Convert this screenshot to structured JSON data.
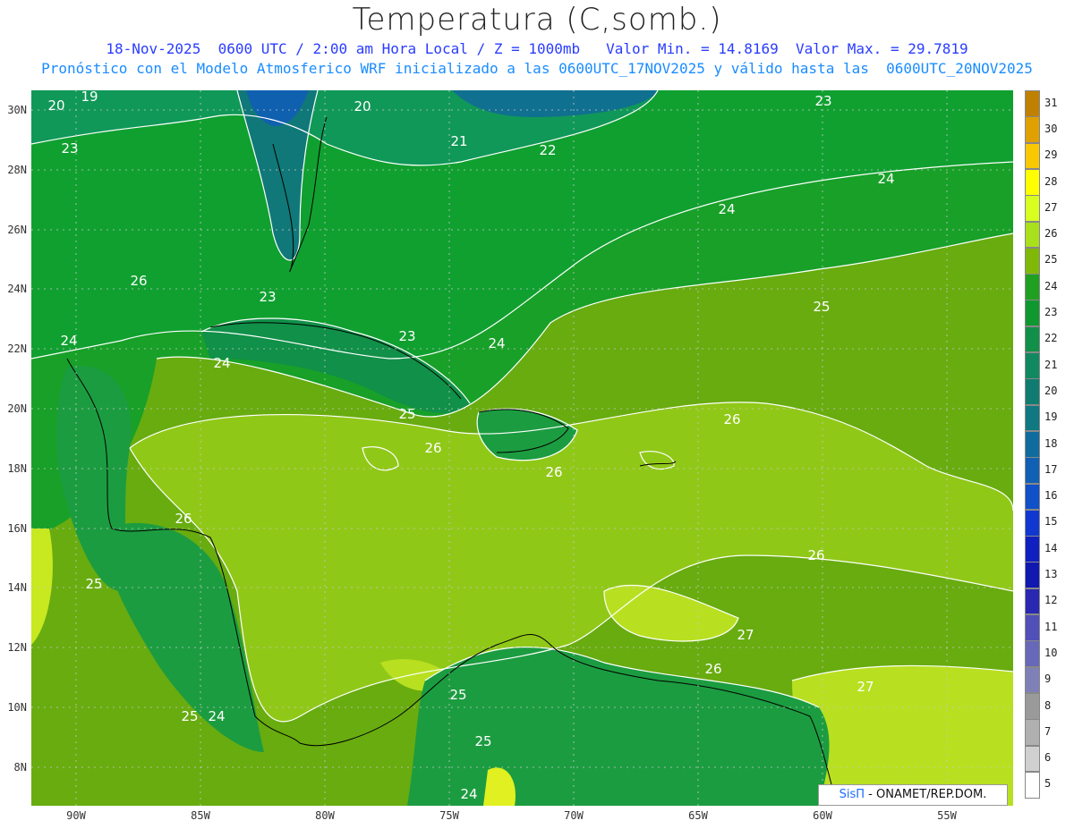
{
  "header": {
    "title": "Temperatura (C,somb.)",
    "line1": "18-Nov-2025  0600 UTC / 2:00 am Hora Local / Z = 1000mb   Valor Min. = 14.8169  Valor Max. = 29.7819",
    "line2": "Pronóstico con el Modelo Atmosferico WRF inicializado a las 0600UTC_17NOV2025 y válido hasta las  0600UTC_20NOV2025"
  },
  "axes": {
    "lat_labels": [
      "30N",
      "28N",
      "26N",
      "24N",
      "22N",
      "20N",
      "18N",
      "16N",
      "14N",
      "12N",
      "10N",
      "8N"
    ],
    "lon_labels": [
      "90W",
      "85W",
      "80W",
      "75W",
      "70W",
      "65W",
      "60W",
      "55W"
    ]
  },
  "contour_labels": [
    "19",
    "20",
    "20",
    "21",
    "22",
    "23",
    "23",
    "23",
    "23",
    "24",
    "24",
    "24",
    "24",
    "24",
    "25",
    "25",
    "25",
    "25",
    "25",
    "26",
    "26",
    "26",
    "26",
    "26",
    "26",
    "27",
    "27",
    "24",
    "25",
    "24",
    "26"
  ],
  "colorbar": {
    "labels": [
      "31",
      "30",
      "29",
      "28",
      "27",
      "26",
      "25",
      "24",
      "23",
      "22",
      "21",
      "20",
      "19",
      "18",
      "17",
      "16",
      "15",
      "14",
      "13",
      "12",
      "11",
      "10",
      "9",
      "8",
      "7",
      "6",
      "5"
    ],
    "colors": [
      "#c08000",
      "#e0a000",
      "#f8c800",
      "#ffff00",
      "#d8ff20",
      "#a8e01c",
      "#80b808",
      "#20a020",
      "#109830",
      "#109048",
      "#108860",
      "#107c70",
      "#107880",
      "#106c9c",
      "#1060b4",
      "#1050c8",
      "#1038d0",
      "#1020c0",
      "#1018b0",
      "#2828b0",
      "#5050b8",
      "#6868b8",
      "#8080b8",
      "#9a9a9a",
      "#b0b0b0",
      "#d0d0d0",
      "#ffffff"
    ]
  },
  "logo": {
    "brand": "SisΠ",
    "text": "- ONAMET/REP.DOM."
  }
}
